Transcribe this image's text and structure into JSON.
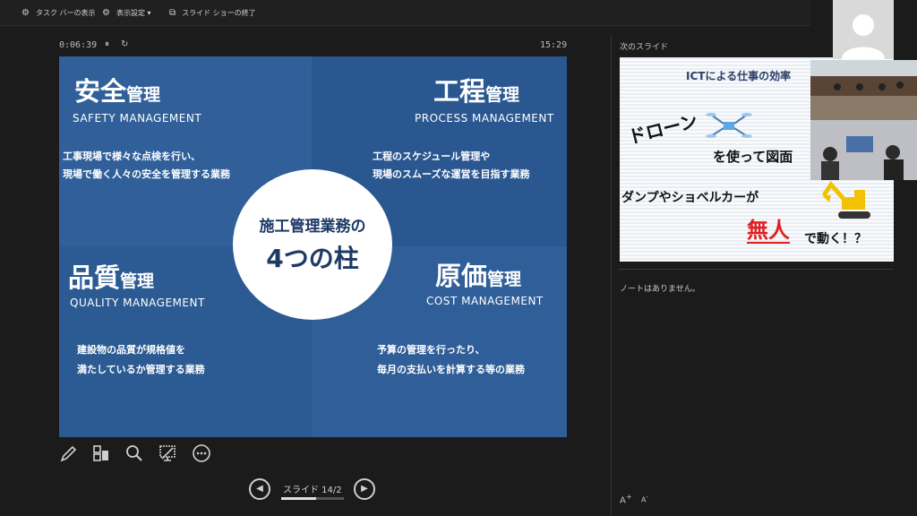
{
  "toolbar": {
    "taskbar_label": "タスク バーの表示",
    "display_settings_label": "表示設定 ▾",
    "end_show_label": "スライド ショーの終了"
  },
  "timer": {
    "elapsed": "0:06:39",
    "clock": "15:29"
  },
  "slide": {
    "center_line1": "施工管理業務の",
    "center_line2": "4つの柱",
    "safety": {
      "kanji": "安全",
      "suffix": "管理",
      "english": "SAFETY MANAGEMENT",
      "line1": "工事現場で様々な点検を行い、",
      "line2": "現場で働く人々の安全を管理する業務"
    },
    "process": {
      "kanji": "工程",
      "suffix": "管理",
      "english": "PROCESS MANAGEMENT",
      "line1": "工程のスケジュール管理や",
      "line2": "現場のスムーズな運営を目指す業務"
    },
    "quality": {
      "kanji": "品質",
      "suffix": "管理",
      "english": "QUALITY MANAGEMENT",
      "line1": "建設物の品質が規格値を",
      "line2": "満たしているか管理する業務"
    },
    "cost": {
      "kanji": "原価",
      "suffix": "管理",
      "english": "COST MANAGEMENT",
      "line1": "予算の管理を行ったり、",
      "line2": "毎月の支払いを計算する等の業務"
    }
  },
  "navigation": {
    "slide_counter": "スライド 14/2",
    "progress": 0.55
  },
  "side": {
    "next_label": "次のスライド",
    "notes_text": "ノートはありません。",
    "font_increase": "A",
    "font_decrease": "A"
  },
  "next_slide": {
    "title": "ICTによる仕事の効率",
    "drone": "ドローン",
    "drone_suffix": "を使って図面",
    "line2": "ダンプやショベルカーが",
    "unmanned": "無人",
    "line3_suffix": "で動く！？"
  },
  "colors": {
    "slide_blue": "#2f5d96",
    "accent_red": "#e02020",
    "excavator_yellow": "#f2c200",
    "drone_blue": "#5aa9e6"
  },
  "icons": [
    "taskbar-icon",
    "display-settings-icon",
    "end-show-icon",
    "pause-icon",
    "reset-icon",
    "pen-icon",
    "slides-grid-icon",
    "zoom-icon",
    "screen-icon",
    "more-icon",
    "prev-icon",
    "next-icon",
    "drone-icon",
    "excavator-icon",
    "avatar-icon"
  ]
}
